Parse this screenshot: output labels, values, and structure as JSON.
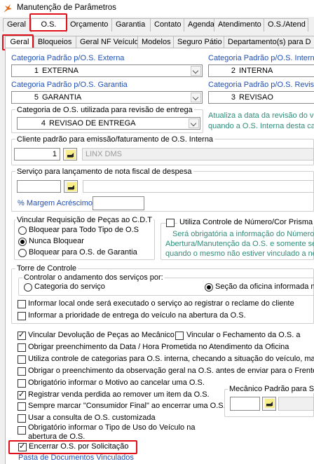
{
  "window": {
    "title": "Manutenção de Parâmetros"
  },
  "top_tabs": [
    "Geral",
    "O.S.",
    "Orçamento",
    "Garantia",
    "Contato",
    "Agenda",
    "Atendimento",
    "O.S./Atend"
  ],
  "sub_tabs": [
    "Geral",
    "Bloqueios",
    "Geral NF Veículos",
    "Modelos",
    "Seguro Pátio",
    "Departamento(s) para D"
  ],
  "categoria_externa": {
    "label": "Categoria Padrão p/O.S. Externa",
    "code": "1",
    "value": "EXTERNA"
  },
  "categoria_interna": {
    "label": "Categoria Padrão p/O.S. Intern",
    "code": "2",
    "value": "INTERNA"
  },
  "categoria_garantia": {
    "label": "Categoria Padrão p/O.S. Garantia",
    "code": "5",
    "value": "GARANTIA"
  },
  "categoria_revisao": {
    "label": "Categoria Padrão p/O.S. Revisã",
    "code": "3",
    "value": "REVISAO"
  },
  "revisao_entrega": {
    "label": "Categoria de O.S. utilizada para revisão de entrega",
    "code": "4",
    "value": "REVISAO DE ENTREGA",
    "note_line1": "Atualiza a data da revisão do ve",
    "note_line2": "quando a O.S. Interna desta ca"
  },
  "cliente_padrao": {
    "label": "Cliente padrão para emissão/faturamento de O.S. Interna",
    "code": "1",
    "value": "LINX DMS"
  },
  "servico_nf": {
    "label": "Serviço para lançamento de nota fiscal de despesa"
  },
  "margem_acrescimo": {
    "label": "% Margem Acréscimo",
    "value": ""
  },
  "vincular_requisicao": {
    "label": "Vincular Requisição de Peças ao C.D.T",
    "options": [
      "Bloquear para Todo Tipo de O.S",
      "Nunca Bloquear",
      "Bloquear para O.S. de Garantia"
    ],
    "selected": 1
  },
  "controle_numero": {
    "label": "Utiliza Controle de Número/Cor Prisma",
    "note_line1": "Será obrigatória a informação do Número/",
    "note_line2": "Abertura/Manutenção da O.S. e somente se",
    "note_line3": "quando o mesmo não estiver vinculado a ner"
  },
  "torre_controle": {
    "label": "Torre de Controle",
    "controlar_label": "Controlar o andamento dos serviços por:",
    "opt_categoria": "Categoria do serviço",
    "opt_secao": "Seção da oficina informada na",
    "informar_local": "Informar local onde será executado o serviço ao registrar o reclame do cliente",
    "informar_prioridade": "Informar a prioridade de entrega do veículo na abertura da O.S."
  },
  "checks": [
    {
      "label": "Vincular Devolução de Peças ao Mecânico",
      "checked": true
    },
    {
      "label": "Obrigar preenchimento da Data / Hora Prometida no Atendimento da Oficina",
      "checked": false
    },
    {
      "label": "Utiliza controle de categorias para O.S. interna, checando a situação do veículo, marc",
      "checked": false
    },
    {
      "label": "Obrigar o preenchimento da observação geral na O.S. antes de enviar para o Frente",
      "checked": false
    },
    {
      "label": "Obrigatório informar o Motivo ao cancelar uma O.S.",
      "checked": false
    },
    {
      "label": "Registrar venda perdida ao remover um item da O.S.",
      "checked": true
    },
    {
      "label": "Sempre marcar \"Consumidor Final\" ao encerrar uma O.S.",
      "checked": false
    },
    {
      "label": "Usar a consulta de O.S. customizada",
      "checked": false
    },
    {
      "label": "Obrigatório informar o Tipo de Uso do Veículo na",
      "label2": "abertura de O.S.",
      "checked": false
    },
    {
      "label": "Encerrar O.S. por Solicitação",
      "checked": true
    }
  ],
  "vincular_fechamento": {
    "label": "Vincular o Fechamento da O.S. a",
    "checked": false
  },
  "mecanico_padrao": {
    "label": "Mecânico Padrão para Se"
  },
  "pasta_documentos": {
    "label": "Pasta de Documentos Vinculados"
  },
  "colors": {
    "label_blue": "#1f4fb5",
    "note_teal": "#2f8c79",
    "highlight_red": "#e0101a"
  }
}
